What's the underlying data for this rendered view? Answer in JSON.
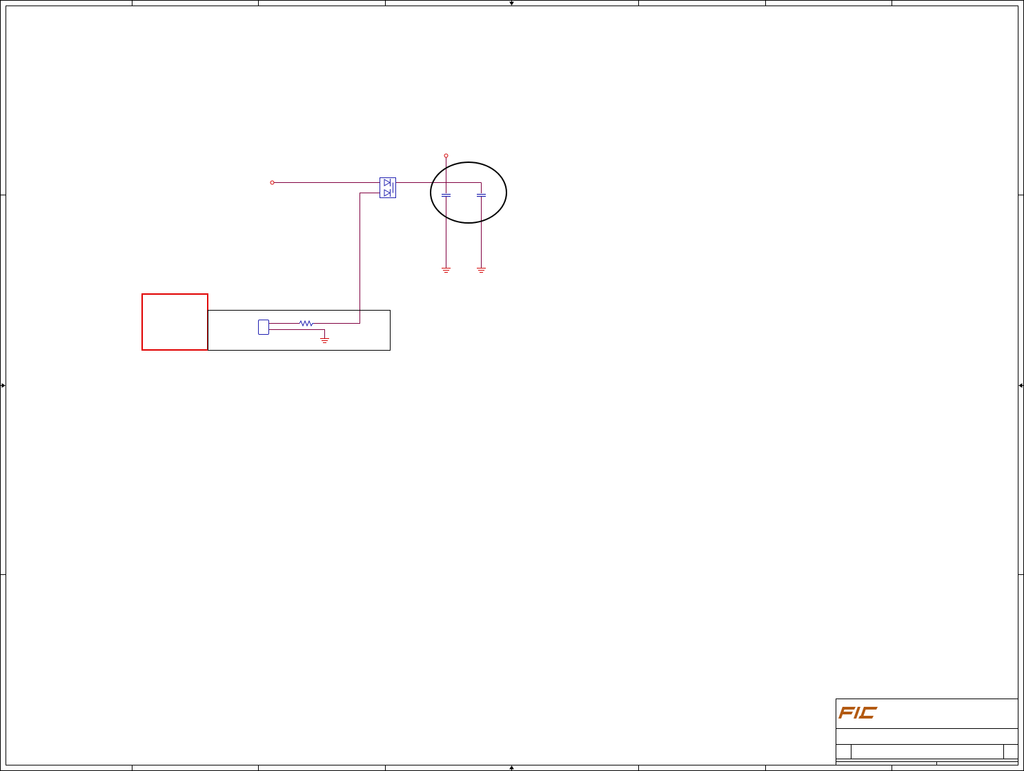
{
  "document": {
    "type": "schematic-sheet",
    "background": "#ffffff",
    "text_content": []
  },
  "colors": {
    "frame": "#000000",
    "wire": "#800040",
    "part": "#1f1fb0",
    "power": "#d40000",
    "highlight_box": "#e00000",
    "logo": "#b35a12"
  },
  "frame": {
    "zones_horizontal": 8,
    "zones_vertical": 4
  },
  "components": [
    {
      "kind": "net-port",
      "icon": "open-circle-port"
    },
    {
      "kind": "dual-diode",
      "icon": "dual-diode-symbol"
    },
    {
      "kind": "power-port",
      "icon": "power-symbol"
    },
    {
      "kind": "capacitor",
      "icon": "capacitor-symbol"
    },
    {
      "kind": "capacitor",
      "icon": "capacitor-symbol"
    },
    {
      "kind": "ground",
      "icon": "ground-symbol"
    },
    {
      "kind": "ground",
      "icon": "ground-symbol"
    },
    {
      "kind": "connector",
      "icon": "connector-symbol"
    },
    {
      "kind": "resistor",
      "icon": "resistor-symbol"
    },
    {
      "kind": "ground",
      "icon": "ground-symbol"
    }
  ],
  "annotations": [
    {
      "kind": "review-ellipse",
      "icon": "ellipse-marker"
    },
    {
      "kind": "highlight-box",
      "icon": "red-rectangle"
    },
    {
      "kind": "sub-block-outline",
      "icon": "block-rectangle"
    }
  ],
  "title_block": {
    "logo_icon": "company-logo"
  }
}
